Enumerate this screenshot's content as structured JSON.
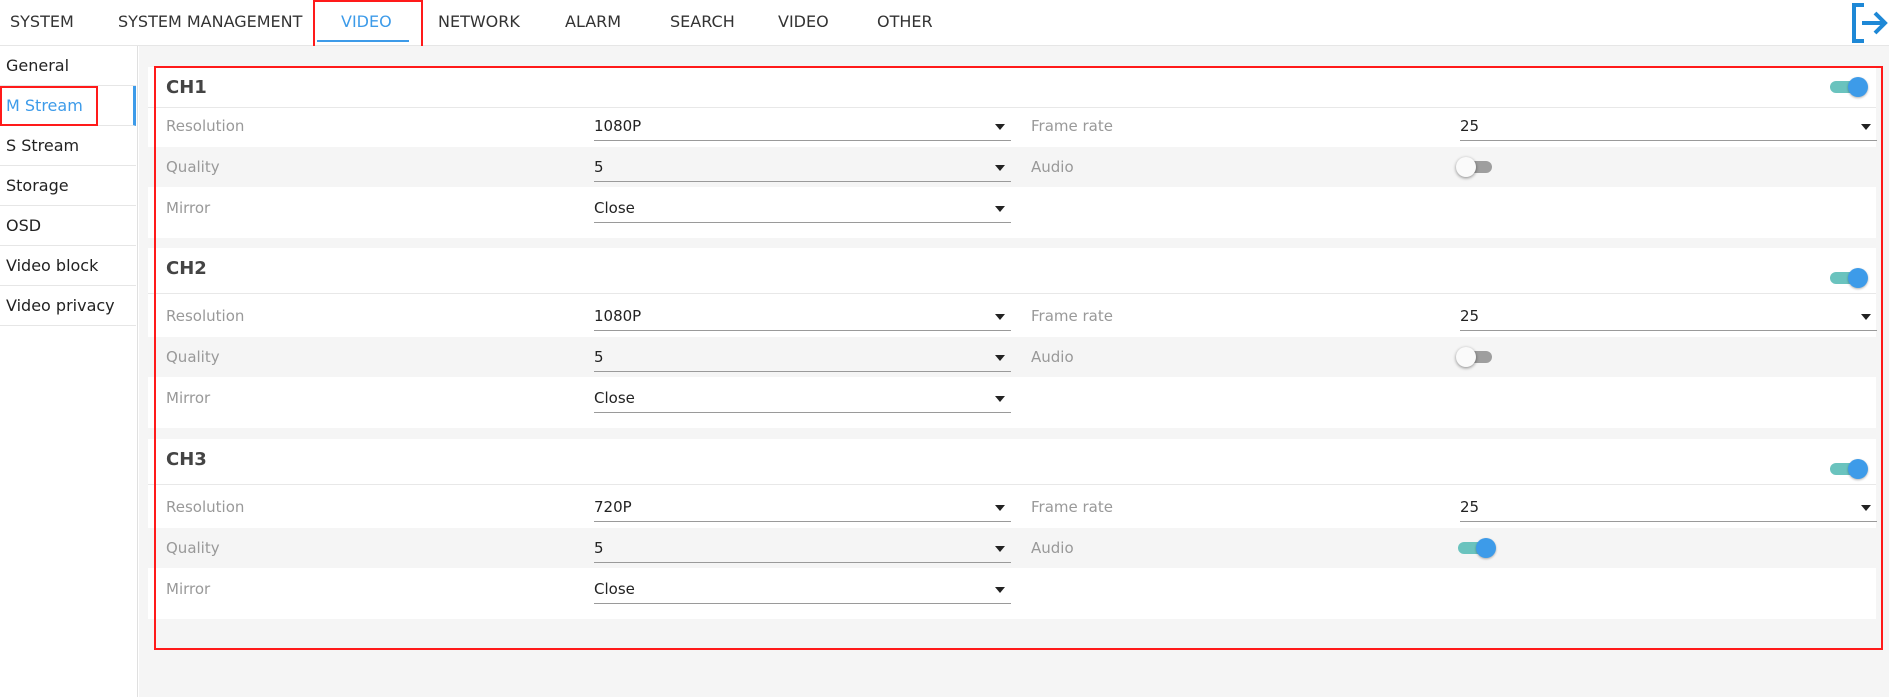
{
  "nav": {
    "items": [
      "SYSTEM",
      "SYSTEM MANAGEMENT",
      "VIDEO",
      "NETWORK",
      "ALARM",
      "SEARCH",
      "VIDEO",
      "OTHER"
    ],
    "active_index": 2,
    "logout_icon": "logout-icon"
  },
  "sidebar": {
    "items": [
      "General",
      "M Stream",
      "S Stream",
      "Storage",
      "OSD",
      "Video block",
      "Video privacy"
    ],
    "active_index": 1
  },
  "colors": {
    "accent": "#3d9be9",
    "annotation": "#ff1a1a",
    "toggle_track_on": "#6ac3be"
  },
  "labels": {
    "resolution": "Resolution",
    "frame_rate": "Frame rate",
    "quality": "Quality",
    "audio": "Audio",
    "mirror": "Mirror"
  },
  "channels": [
    {
      "name": "CH1",
      "enabled": true,
      "resolution": "1080P",
      "frame_rate": "25",
      "quality": "5",
      "audio": false,
      "mirror": "Close"
    },
    {
      "name": "CH2",
      "enabled": true,
      "resolution": "1080P",
      "frame_rate": "25",
      "quality": "5",
      "audio": false,
      "mirror": "Close"
    },
    {
      "name": "CH3",
      "enabled": true,
      "resolution": "720P",
      "frame_rate": "25",
      "quality": "5",
      "audio": true,
      "mirror": "Close"
    }
  ]
}
